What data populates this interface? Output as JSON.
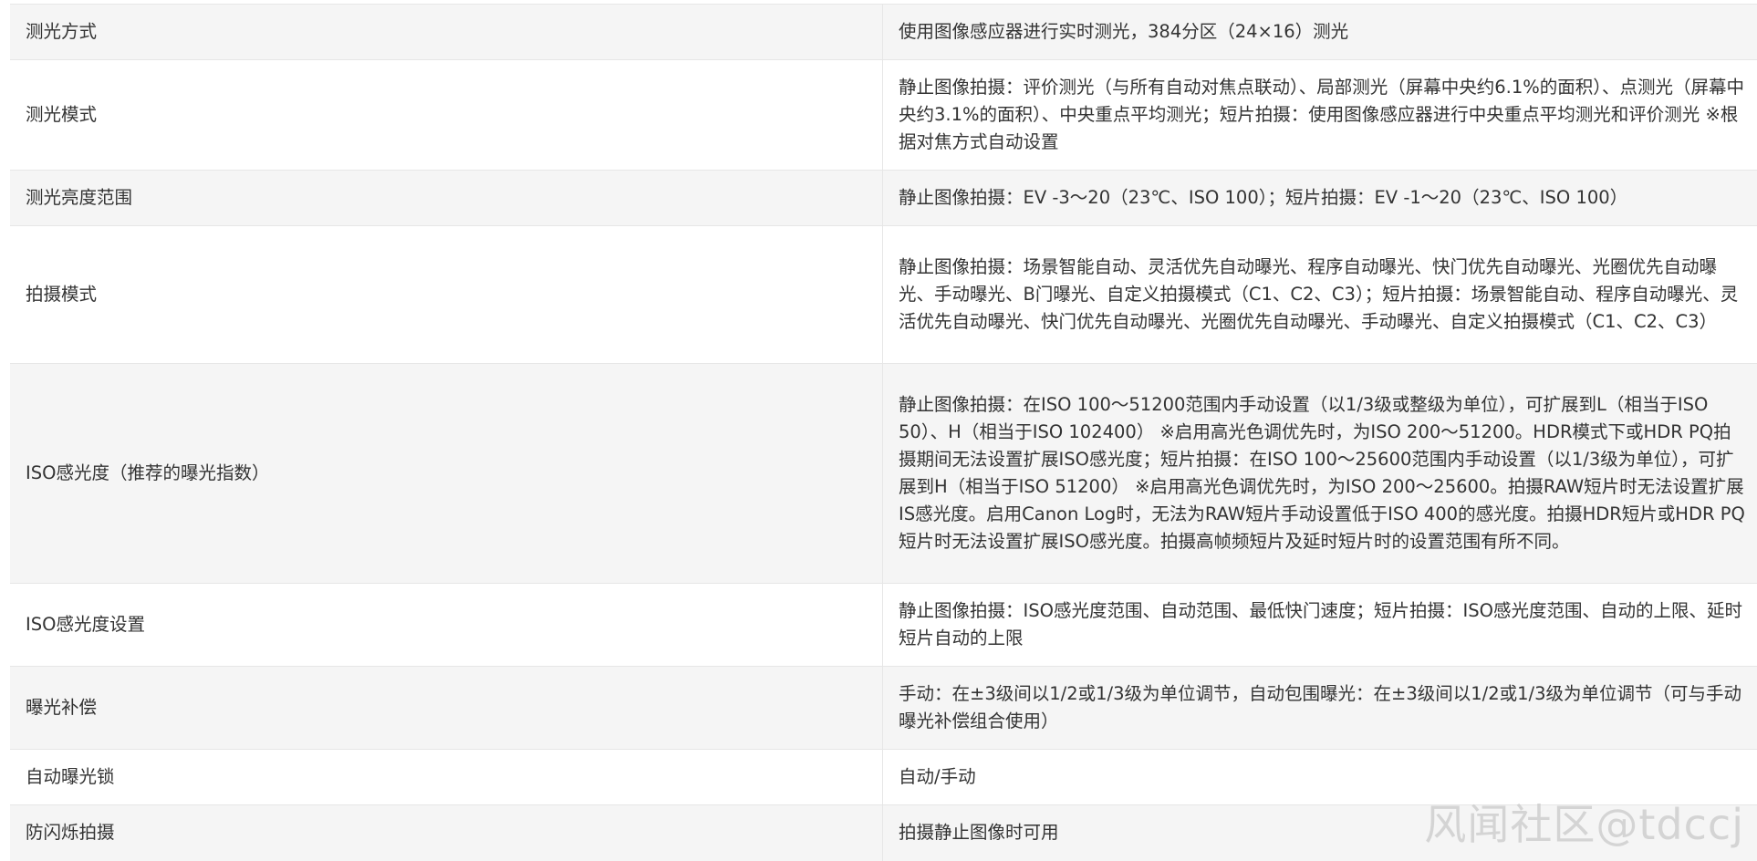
{
  "specs": [
    {
      "label": "测光方式",
      "value": "使用图像感应器进行实时测光，384分区（24×16）测光"
    },
    {
      "label": "测光模式",
      "value": "静止图像拍摄：评价测光（与所有自动对焦点联动）、局部测光（屏幕中央约6.1%的面积）、点测光（屏幕中央约3.1%的面积）、中央重点平均测光；短片拍摄：使用图像感应器进行中央重点平均测光和评价测光 ※根据对焦方式自动设置"
    },
    {
      "label": "测光亮度范围",
      "value": "静止图像拍摄：EV -3～20（23℃、ISO 100）；短片拍摄：EV -1～20（23℃、ISO 100）"
    },
    {
      "label": "拍摄模式",
      "value": "静止图像拍摄：场景智能自动、灵活优先自动曝光、程序自动曝光、快门优先自动曝光、光圈优先自动曝光、手动曝光、B门曝光、自定义拍摄模式（C1、C2、C3）；短片拍摄：场景智能自动、程序自动曝光、灵活优先自动曝光、快门优先自动曝光、光圈优先自动曝光、手动曝光、自定义拍摄模式（C1、C2、C3）"
    },
    {
      "label": "ISO感光度（推荐的曝光指数）",
      "value": "静止图像拍摄：在ISO 100～51200范围内手动设置（以1/3级或整级为单位），可扩展到L（相当于ISO 50）、H（相当于ISO 102400） ※启用高光色调优先时，为ISO 200～51200。HDR模式下或HDR PQ拍摄期间无法设置扩展ISO感光度；短片拍摄：在ISO 100～25600范围内手动设置（以1/3级为单位），可扩展到H（相当于ISO 51200） ※启用高光色调优先时，为ISO 200～25600。拍摄RAW短片时无法设置扩展IS感光度。启用Canon Log时，无法为RAW短片手动设置低于ISO 400的感光度。拍摄HDR短片或HDR PQ短片时无法设置扩展ISO感光度。拍摄高帧频短片及延时短片时的设置范围有所不同。"
    },
    {
      "label": "ISO感光度设置",
      "value": "静止图像拍摄：ISO感光度范围、自动范围、最低快门速度；短片拍摄：ISO感光度范围、自动的上限、延时短片自动的上限"
    },
    {
      "label": "曝光补偿",
      "value": "手动：在±3级间以1/2或1/3级为单位调节，自动包围曝光：在±3级间以1/2或1/3级为单位调节（可与手动曝光补偿组合使用）"
    },
    {
      "label": "自动曝光锁",
      "value": "自动/手动"
    },
    {
      "label": "防闪烁拍摄",
      "value": "拍摄静止图像时可用"
    }
  ],
  "watermark": "风闻社区@tdccj"
}
